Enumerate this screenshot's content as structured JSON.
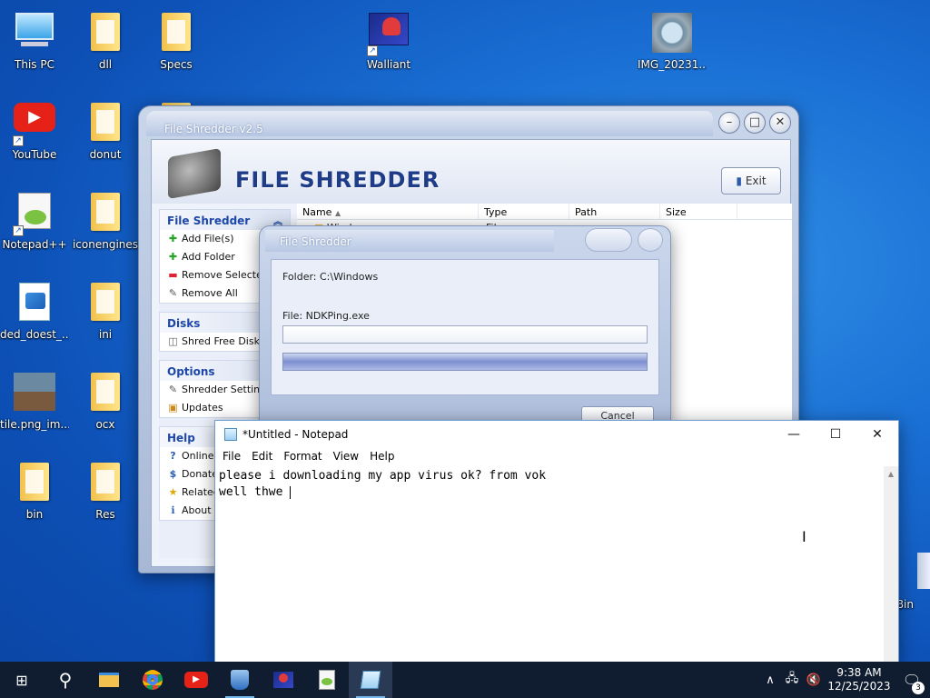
{
  "desktop": {
    "icons": [
      {
        "label": "This PC"
      },
      {
        "label": "dll"
      },
      {
        "label": "Specs"
      },
      {
        "label": "Walliant"
      },
      {
        "label": "IMG_20231..."
      },
      {
        "label": "YouTube"
      },
      {
        "label": "donut"
      },
      {
        "label": "Notepad++"
      },
      {
        "label": "iconengines"
      },
      {
        "label": "ded_doest_..."
      },
      {
        "label": "ini"
      },
      {
        "label": "tile.png_im..."
      },
      {
        "label": "ocx"
      },
      {
        "label": "bin"
      },
      {
        "label": "Res"
      },
      {
        "label": "Bin"
      }
    ]
  },
  "file_shredder": {
    "title": "File Shredder v2.5",
    "brand": "FILE SHREDDER",
    "exit_label": "Exit",
    "groups": {
      "file_shredder": {
        "header": "File Shredder",
        "items": [
          "Add File(s)",
          "Add Folder",
          "Remove Selected",
          "Remove All"
        ]
      },
      "disks": {
        "header": "Disks",
        "items": [
          "Shred Free Disk S"
        ]
      },
      "options": {
        "header": "Options",
        "items": [
          "Shredder Setting",
          "Updates"
        ]
      },
      "help": {
        "header": "Help",
        "items": [
          "Online H",
          "Donate",
          "Related",
          "About"
        ]
      }
    },
    "columns": [
      "Name",
      "Type",
      "Path",
      "Size"
    ],
    "rows": [
      {
        "name": "Windows",
        "type": "File"
      }
    ]
  },
  "progress_dialog": {
    "title": "File Shredder",
    "folder_label": "Folder: C:\\Windows",
    "file_label": "File: NDKPing.exe",
    "cancel_label": "Cancel"
  },
  "notepad": {
    "title": "*Untitled - Notepad",
    "menu": [
      "File",
      "Edit",
      "Format",
      "View",
      "Help"
    ],
    "lines": [
      "please i downloading my app virus ok? from vok",
      "well thwe "
    ]
  },
  "taskbar": {
    "time": "9:38 AM",
    "date": "12/25/2023",
    "notification_count": "3"
  },
  "colors": {
    "desktop_blue": "#1a6fd4",
    "taskbar": "#101c2f",
    "shredder_accent": "#1d47a8"
  }
}
